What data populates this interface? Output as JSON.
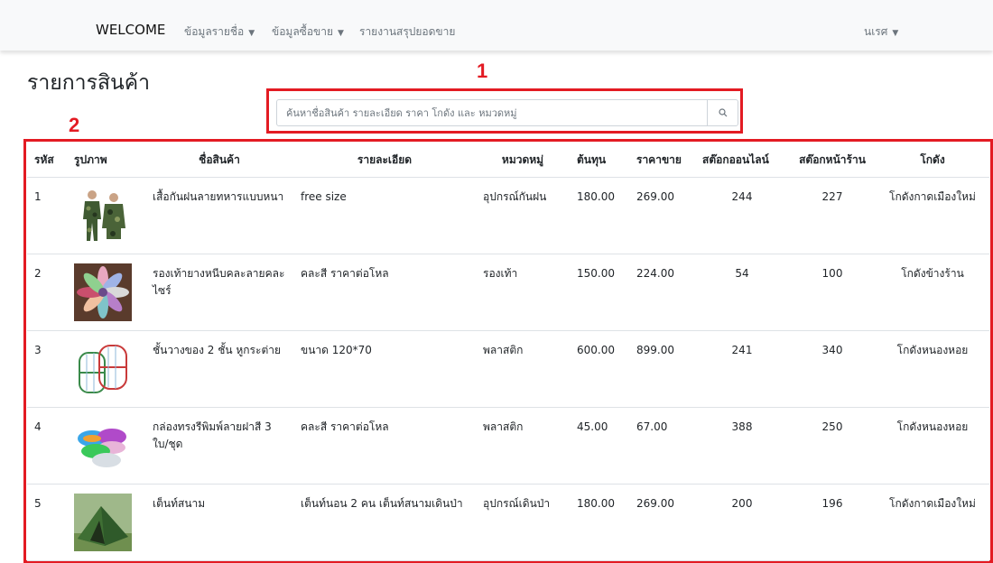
{
  "navbar": {
    "brand": "WELCOME",
    "items": [
      {
        "label": "ข้อมูลรายชื่อ",
        "dropdown": true
      },
      {
        "label": "ข้อมูลซื้อขาย",
        "dropdown": true
      },
      {
        "label": "รายงานสรุปยอดขาย",
        "dropdown": false
      }
    ],
    "user": {
      "label": "นเรศ",
      "dropdown": true
    }
  },
  "page": {
    "title": "รายการสินค้า"
  },
  "search": {
    "placeholder": "ค้นหาชื่อสินค้า รายละเอียด ราคา โกดัง และ หมวดหมู่",
    "value": ""
  },
  "annotations": [
    {
      "label": "1"
    },
    {
      "label": "2"
    }
  ],
  "colors": {
    "annotation": "#e31b23",
    "navbar_bg": "#f8f9fa"
  },
  "table": {
    "headers": [
      "รหัส",
      "รูปภาพ",
      "ชื่อสินค้า",
      "รายละเอียด",
      "หมวดหมู่",
      "ต้นทุน",
      "ราคาขาย",
      "สต๊อกออนไลน์",
      "สต๊อกหน้าร้าน",
      "โกดัง"
    ],
    "rows": [
      {
        "id": "1",
        "image": "camouflage-raincoat-photo",
        "name": "เสื้อกันฝนลายทหารแบบหนา",
        "detail": "free size",
        "category": "อุปกรณ์กันฝน",
        "cost": "180.00",
        "price": "269.00",
        "stock_online": "244",
        "stock_store": "227",
        "warehouse": "โกดังกาดเมืองใหม่"
      },
      {
        "id": "2",
        "image": "rubber-slippers-photo",
        "name": "รองเท้ายางหนีบคละลายคละไซร์",
        "detail": "คละสี ราคาต่อโหล",
        "category": "รองเท้า",
        "cost": "150.00",
        "price": "224.00",
        "stock_online": "54",
        "stock_store": "100",
        "warehouse": "โกดังข้างร้าน"
      },
      {
        "id": "3",
        "image": "plastic-shelf-photo",
        "name": "ชั้นวางของ 2 ชั้น หูกระต่าย",
        "detail": "ขนาด 120*70",
        "category": "พลาสติก",
        "cost": "600.00",
        "price": "899.00",
        "stock_online": "241",
        "stock_store": "340",
        "warehouse": "โกดังหนองหอย"
      },
      {
        "id": "4",
        "image": "plastic-boxes-photo",
        "name": "กล่องทรงรีพิมพ์ลายฝาสี 3 ใบ/ชุด",
        "detail": "คละสี ราคาต่อโหล",
        "category": "พลาสติก",
        "cost": "45.00",
        "price": "67.00",
        "stock_online": "388",
        "stock_store": "250",
        "warehouse": "โกดังหนองหอย"
      },
      {
        "id": "5",
        "image": "camping-tent-photo",
        "name": "เต็นท์สนาม",
        "detail": "เต็นท์นอน 2 คน เต็นท์สนามเดินป่า",
        "category": "อุปกรณ์เดินป่า",
        "cost": "180.00",
        "price": "269.00",
        "stock_online": "200",
        "stock_store": "196",
        "warehouse": "โกดังกาดเมืองใหม่"
      }
    ]
  }
}
